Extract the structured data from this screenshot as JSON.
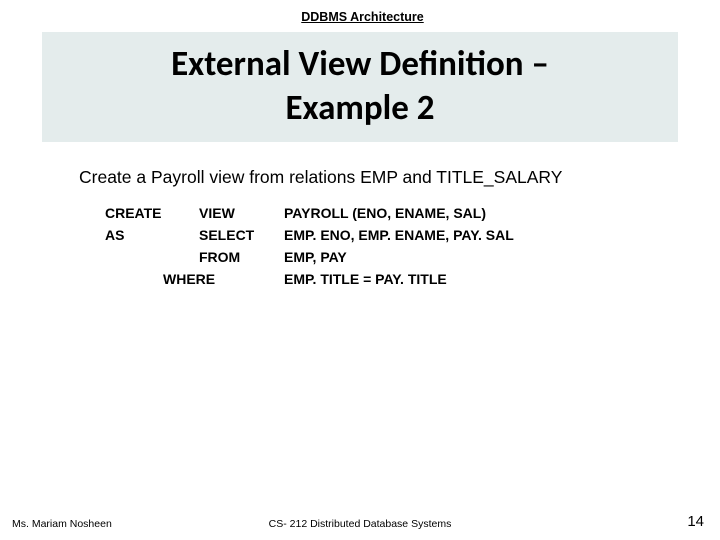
{
  "header": {
    "label": "DDBMS Architecture"
  },
  "title": {
    "line1": "External View Definition –",
    "line2": "Example 2"
  },
  "instruction": "Create a Payroll view from relations EMP and TITLE_SALARY",
  "sql": {
    "rows": [
      {
        "a": "CREATE",
        "b": "VIEW",
        "c": "PAYROLL (ENO, ENAME, SAL)"
      },
      {
        "a": "AS",
        "b": "SELECT",
        "c": "EMP. ENO, EMP. ENAME, PAY. SAL"
      },
      {
        "a": "",
        "b": "FROM",
        "c": "EMP, PAY"
      }
    ],
    "where": {
      "kw": "WHERE",
      "c": "EMP. TITLE = PAY. TITLE"
    }
  },
  "footer": {
    "left": "Ms. Mariam Nosheen",
    "center": "CS- 212 Distributed Database Systems",
    "right": "14"
  }
}
